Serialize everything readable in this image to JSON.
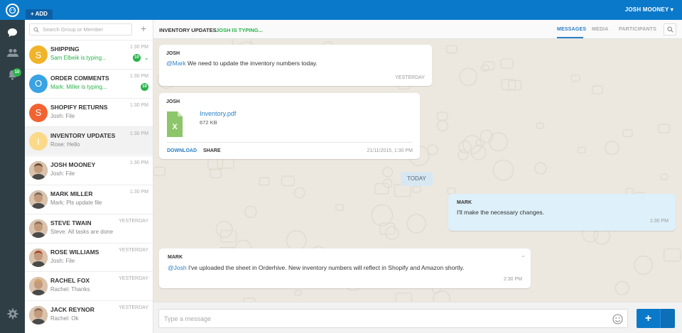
{
  "topbar": {
    "add_label": "+ ADD",
    "user_name": "JOSH MOONEY",
    "user_caret": "▾"
  },
  "rail": {
    "notification_count": "10"
  },
  "search": {
    "placeholder": "Search Group or Member"
  },
  "conversations": [
    {
      "initial": "S",
      "color": "#f0b42a",
      "name": "SHIPPING",
      "preview": "Sam Elbeik is typing...",
      "typing": true,
      "time": "1:30 PM",
      "badge": "10"
    },
    {
      "initial": "O",
      "color": "#3aa3e3",
      "name": "ORDER COMMENTS",
      "preview": "Mark: Miller is typing...",
      "typing": true,
      "time": "1:30 PM",
      "badge": "10"
    },
    {
      "initial": "S",
      "color": "#f26331",
      "name": "SHOPIFY RETURNS",
      "preview": "Josh: File",
      "time": "1:30 PM"
    },
    {
      "initial": "I",
      "color": "#fad989",
      "name": "INVENTORY UPDATES",
      "preview": "Rose: Hello",
      "time": "1:30 PM"
    },
    {
      "name": "JOSH MOONEY",
      "preview": "Josh: File",
      "time": "1:30 PM",
      "color": "#6b4a3a"
    },
    {
      "name": "MARK MILLER",
      "preview": "Mark: Pls update file",
      "time": "1:30 PM",
      "color": "#7a6a5e"
    },
    {
      "name": "STEVE TWAIN",
      "preview": "Steve: All tasks are done",
      "time": "YESTERDAY",
      "color": "#8a7060"
    },
    {
      "name": "ROSE WILLIAMS",
      "preview": "Josh: File",
      "time": "YESTERDAY",
      "color": "#a84a30"
    },
    {
      "name": "RACHEL FOX",
      "preview": "Rachel: Thanks",
      "time": "YESTERDAY",
      "color": "#d6a36a"
    },
    {
      "name": "JACK REYNOR",
      "preview": "Rachel: Ok",
      "time": "YESTERDAY",
      "color": "#8a6a5a"
    }
  ],
  "chat": {
    "title": "INVENTORY UPDATES",
    "typing": "JOSH IS TYPING...",
    "tabs": [
      "MESSAGES",
      "MEDIA",
      "PARTICIPANTS"
    ],
    "active_tab": "MESSAGES",
    "messages": {
      "m1": {
        "sender": "JOSH",
        "mention": "@Mark",
        "text": " We need to update the inventory numbers today.",
        "time": "YESTERDAY"
      },
      "m2": {
        "sender": "JOSH",
        "file_name": "Inventory.pdf",
        "file_size": "672 KB",
        "download": "DOWNLOAD",
        "share": "SHARE",
        "time": "21/11/2015, 1:30 PM"
      },
      "divider": "TODAY",
      "m3": {
        "sender": "MARK",
        "text": "I'll make the necessary changes.",
        "time": "1:30 PM"
      },
      "m4": {
        "sender": "MARK",
        "mention": "@Josh",
        "text": "  I've uploaded the sheet in Orderhive. New inventory numbers will reflect in Shopify and Amazon shortly.",
        "time": "2:30 PM"
      }
    },
    "composer": {
      "placeholder": "Type a message",
      "send_label": "+"
    }
  },
  "colors": {
    "primary": "#0b79c9",
    "rail": "#2f3d45",
    "online": "#28b34b",
    "chat_bg": "#ece8e0"
  }
}
